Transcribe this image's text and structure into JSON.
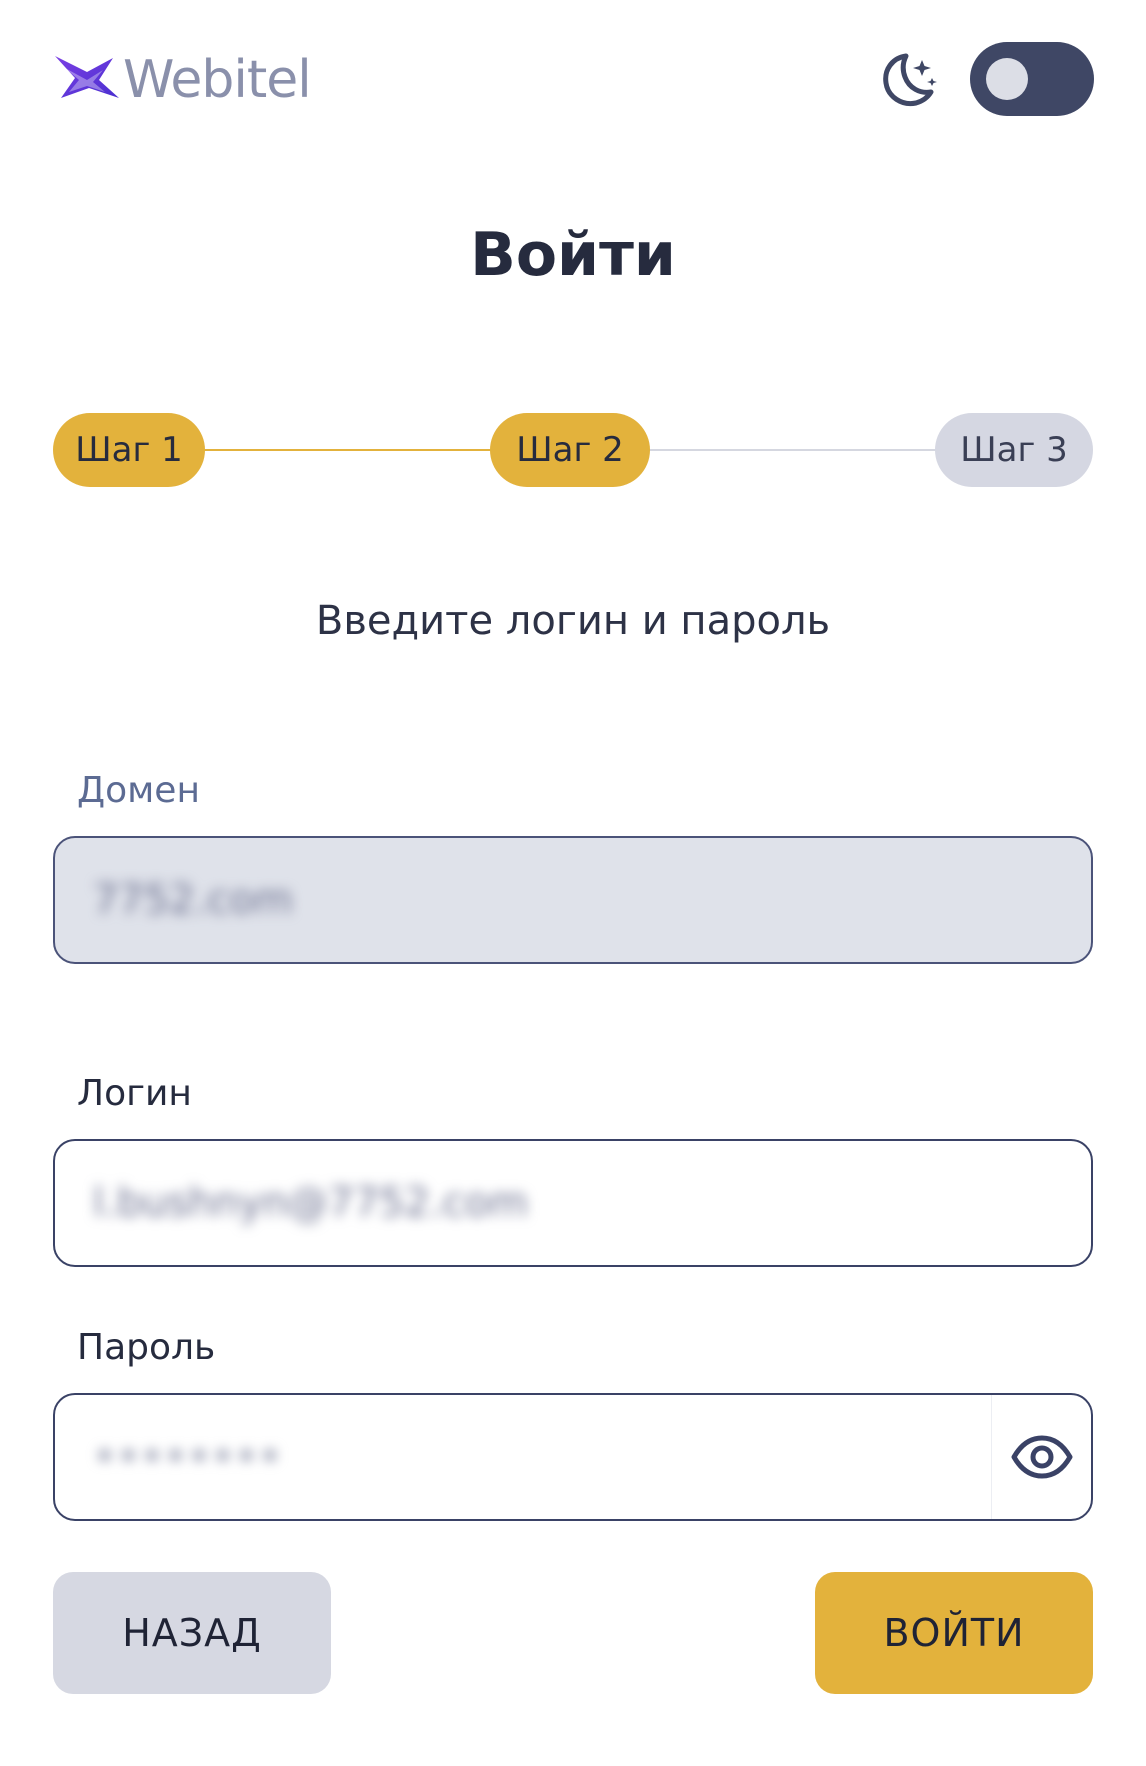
{
  "header": {
    "brand_name": "Webitel",
    "logo_icon": "webitel-logo-icon",
    "theme_icon": "moon-stars-icon",
    "theme_toggle_on": false
  },
  "title": "Войти",
  "stepper": {
    "steps": [
      {
        "label": "Шаг 1",
        "state": "completed"
      },
      {
        "label": "Шаг 2",
        "state": "active"
      },
      {
        "label": "Шаг 3",
        "state": "inactive"
      }
    ]
  },
  "subtitle": "Введите логин и пароль",
  "form": {
    "domain": {
      "label": "Домен",
      "value": "7752.com",
      "disabled": true
    },
    "login": {
      "label": "Логин",
      "value": "l.bushnyn@7752.com"
    },
    "password": {
      "label": "Пароль",
      "value": "••••••••",
      "toggle_icon": "eye-icon"
    }
  },
  "buttons": {
    "back": "НАЗАД",
    "login": "ВОЙТИ"
  },
  "colors": {
    "accent": "#e3b23c",
    "toggle_track": "#3f4765",
    "inactive_step": "#d5d7e2",
    "disabled_field": "#dfe2ea",
    "field_border": "#3a4266",
    "back_button": "#d6d8e2"
  }
}
